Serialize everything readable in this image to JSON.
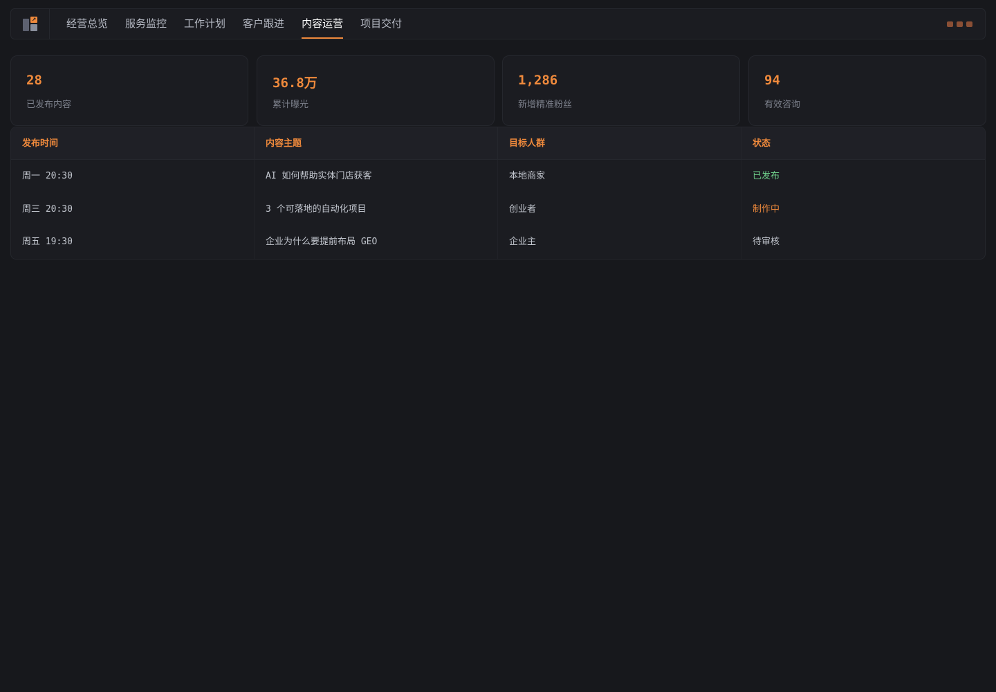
{
  "nav": {
    "items": [
      {
        "label": "经营总览",
        "active": false
      },
      {
        "label": "服务监控",
        "active": false
      },
      {
        "label": "工作计划",
        "active": false
      },
      {
        "label": "客户跟进",
        "active": false
      },
      {
        "label": "内容运营",
        "active": true
      },
      {
        "label": "项目交付",
        "active": false
      }
    ]
  },
  "stats": [
    {
      "value": "28",
      "label": "已发布内容"
    },
    {
      "value": "36.8万",
      "label": "累计曝光"
    },
    {
      "value": "1,286",
      "label": "新增精准粉丝"
    },
    {
      "value": "94",
      "label": "有效咨询"
    }
  ],
  "table": {
    "headers": [
      "发布时间",
      "内容主题",
      "目标人群",
      "状态"
    ],
    "rows": [
      {
        "time": "周一 20:30",
        "topic": "AI 如何帮助实体门店获客",
        "audience": "本地商家",
        "status": "已发布"
      },
      {
        "time": "周三 20:30",
        "topic": "3 个可落地的自动化项目",
        "audience": "创业者",
        "status": "制作中"
      },
      {
        "time": "周五 19:30",
        "topic": "企业为什么要提前布局 GEO",
        "audience": "企业主",
        "status": "待审核"
      }
    ]
  },
  "colors": {
    "accent": "#f08a3c",
    "status_published": "#6fcf8a",
    "background": "#17181c"
  },
  "icons": {
    "logo": "dashboard-logo-icon",
    "window_controls": "window-control-dots"
  }
}
